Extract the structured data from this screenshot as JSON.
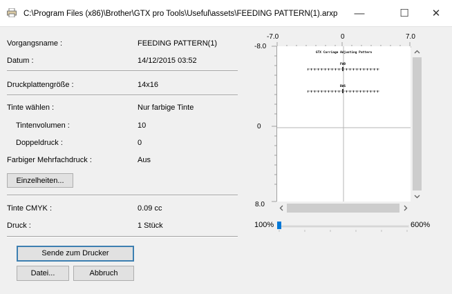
{
  "window": {
    "title": "C:\\Program Files (x86)\\Brother\\GTX pro Tools\\Useful\\assets\\FEEDING PATTERN(1).arxp",
    "minimize": "—",
    "maximize": "☐",
    "close": "✕"
  },
  "info": {
    "job_name_label": "Vorgangsname :",
    "job_name": "FEEDING PATTERN(1)",
    "date_label": "Datum :",
    "date": "14/12/2015 03:52",
    "platen_label": "Druckplattengröße :",
    "platen": "14x16",
    "ink_select_label": "Tinte wählen :",
    "ink_select": "Nur farbige Tinte",
    "ink_volume_label": "Tintenvolumen :",
    "ink_volume": "10",
    "double_print_label": "Doppeldruck :",
    "double_print": "0",
    "multi_print_label": "Farbiger Mehrfachdruck :",
    "multi_print": "Aus",
    "details_button": "Einzelheiten...",
    "ink_cmyk_label": "Tinte CMYK :",
    "ink_cmyk": "0.09 cc",
    "print_label": "Druck :",
    "print_count": "1 Stück"
  },
  "buttons": {
    "send": "Sende zum Drucker",
    "file": "Datei...",
    "cancel": "Abbruch"
  },
  "preview": {
    "x_min": "-7.0",
    "x_mid": "0",
    "x_max": "7.0",
    "y_min": "-8.0",
    "y_mid": "0",
    "y_max": "8.0",
    "pattern_title": "GTX Carriage Adjusting Pattern",
    "label_fwd": "FWD",
    "label_bws": "BWS",
    "zoom_min": "100%",
    "zoom_max": "600%",
    "zoom_value": 0
  },
  "colors": {
    "separator": "#a0a0a0",
    "focus_border": "#3c7fb1",
    "scrollbar_thumb": "#cdcdcd",
    "slider_thumb": "#0078d7"
  }
}
